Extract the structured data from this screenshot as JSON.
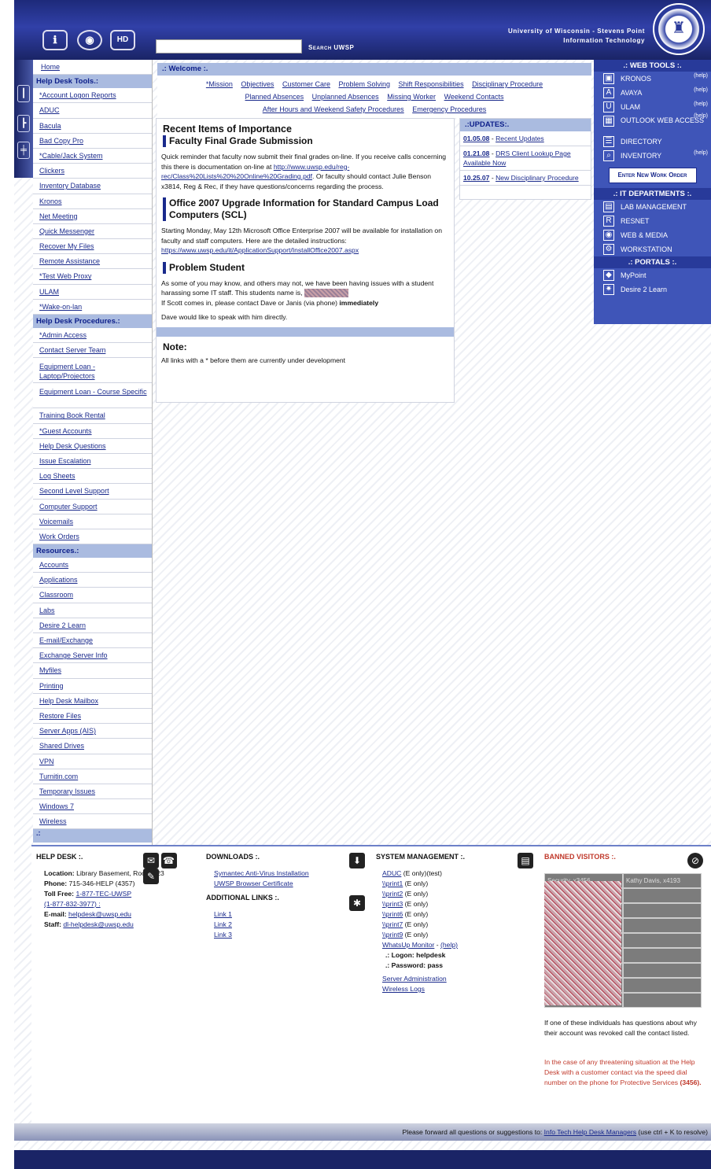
{
  "header": {
    "search_label": "Search UWSP",
    "univ_line1": "University of Wisconsin - Stevens Point",
    "univ_line2": "Information Technology",
    "hd_label": "HD"
  },
  "nav": {
    "home": "Home",
    "tools_head": "Help Desk Tools.:",
    "tools": [
      "*Account Logon Reports",
      "ADUC",
      "Bacula",
      "Bad Copy Pro",
      "*Cable/Jack System",
      "Clickers",
      "Inventory Database",
      "Kronos",
      "Net Meeting",
      "Quick Messenger",
      "Recover My Files",
      "Remote Assistance",
      "*Test Web Proxy",
      "ULAM",
      "*Wake-on-lan"
    ],
    "procedures_head": "Help Desk Procedures.:",
    "procedures": [
      "*Admin Access",
      "Contact Server Team",
      "Equipment Loan - Laptop/Projectors",
      "Equipment Loan - Course Specific",
      "Training Book Rental",
      "*Guest Accounts",
      "Help Desk Questions",
      "Issue Escalation",
      "Log Sheets",
      "Second Level Support",
      "Computer Support",
      "Voicemails",
      "Work Orders"
    ],
    "resources_head": "Resources.:",
    "resources": [
      "Accounts",
      "Applications",
      "Classroom",
      "Labs",
      "Desire 2 Learn",
      "E-mail/Exchange",
      "Exchange Server Info",
      "Myfiles",
      "Printing",
      "Help Desk Mailbox",
      "Restore Files",
      "Server Apps (AIS)",
      "Shared Drives",
      "VPN",
      "Turnitin.com",
      "Temporary Issues",
      "Windows 7",
      "Wireless"
    ],
    "foot": ".:"
  },
  "welcome": {
    "title": ".: Welcome :.",
    "links": [
      "*Mission",
      "Objectives",
      "Customer Care",
      "Problem Solving",
      "Shift Responsibilities",
      "Disciplinary Procedure",
      "Planned Absences",
      "Unplanned Absences",
      "Missing Worker",
      "Weekend Contacts",
      "After Hours and Weekend Safety Procedures",
      "Emergency Procedures"
    ]
  },
  "content": {
    "title": "Recent Items of Importance",
    "item1_title": "Faculty Final Grade Submission",
    "item1_text1": "Quick reminder that faculty now submit their final grades on-line. If you receive calls concerning this there is documentation on-line at",
    "item1_link": "http://www.uwsp.edu/reg-rec/Class%20Lists%20%20Online%20Grading.pdf",
    "item1_text2": ". Or faculty should contact Julie Benson x3814, Reg & Rec, if they have questions/concerns regarding the process.",
    "item2_title": "Office 2007 Upgrade Information for Standard Campus Load Computers (SCL)",
    "item2_text": "Starting Monday, May 12th Microsoft Office Enterprise 2007 will be available for installation on faculty and staff computers. Here are the detailed instructions:",
    "item2_link": "https://www.uwsp.edu/it/ApplicationSupport/InstallOffice2007.aspx",
    "item3_title": "Problem Student",
    "item3_text1": "As some of you may know, and others may not, we have been having issues with a student harassing some IT staff. This students name is,",
    "item3_text2": "If Scott comes in, please contact Dave or Janis (via phone)",
    "item3_bold": "immediately",
    "item3_text3": "Dave would like to speak with him directly.",
    "note_title": "Note:",
    "note_text": "All links with a * before them are currently under development"
  },
  "updates": {
    "title": ".:UPDATES:.",
    "items": [
      {
        "date": "01.05.08",
        "text": "Recent Updates"
      },
      {
        "date": "01.21.08",
        "text": "DRS Client Lookup Page Available Now"
      },
      {
        "date": "10.25.07",
        "text": "New Disciplinary Procedure"
      }
    ]
  },
  "right": {
    "webtools_head": ".: WEB TOOLS :.",
    "webtools": [
      "KRONOS",
      "AVAYA",
      "ULAM",
      "OUTLOOK WEB ACCESS",
      "DIRECTORY",
      "INVENTORY"
    ],
    "help": "(help)",
    "work_order": "Enter New Work Order",
    "depts_head": ".: IT DEPARTMENTS :.",
    "depts": [
      "LAB MANAGEMENT",
      "RESNET",
      "WEB & MEDIA",
      "WORKSTATION"
    ],
    "portals_head": ".: PORTALS :.",
    "portals": [
      "MyPoint",
      "Desire 2 Learn"
    ]
  },
  "footer": {
    "helpdesk_head": "HELP DESK :.",
    "location_label": "Location:",
    "location": "Library Basement, Room 023",
    "phone_label": "Phone:",
    "phone": "715-346-HELP (4357)",
    "tollfree_label": "Toll Free:",
    "tollfree": "1-877-TEC-UWSP",
    "tollfree2": "(1-877-832-3977) :",
    "email_label": "E-mail:",
    "email": "helpdesk@uwsp.edu",
    "staff_label": "Staff:",
    "staff": "dl-helpdesk@uwsp.edu",
    "downloads_head": "DOWNLOADS :.",
    "downloads": [
      "Symantec Anti-Virus Installation",
      "UWSP Browser Certificate"
    ],
    "addl_head": "ADDITIONAL LINKS :.",
    "addl": [
      "Link 1",
      "Link 2",
      "Link 3"
    ],
    "sysmgmt_head": "SYSTEM MANAGEMENT :.",
    "sysmgmt": [
      {
        "link": "ADUC",
        "note": "(E only)(test)"
      },
      {
        "link": "\\\\print1",
        "note": "(E only)"
      },
      {
        "link": "\\\\print2",
        "note": "(E only)"
      },
      {
        "link": "\\\\print3",
        "note": "(E only)"
      },
      {
        "link": "\\\\print6",
        "note": "(E only)"
      },
      {
        "link": "\\\\print7",
        "note": "(E only)"
      },
      {
        "link": "\\\\print9",
        "note": "(E only)"
      }
    ],
    "whatsup": "WhatsUp Monitor",
    "whatsup_help": "(help)",
    "logon": ".: Logon: helpdesk",
    "password": ".: Password: pass",
    "server_admin": "Server Administration",
    "wireless_logs": "Wireless Logs",
    "banned_head": "BANNED VISITORS :.",
    "banned_col1": "Security, x3456",
    "banned_col2": "Kathy Davis, x4193",
    "banned_note": "If one of these individuals has questions about why their account was revoked call the contact listed.",
    "banned_warn": "In the case of any threatening situation at the Help Desk with a customer contact via the speed dial number on the phone for Protective Services",
    "banned_warn_num": "(3456)."
  },
  "bottom": {
    "text": "Please forward all questions or suggestions to:",
    "link": "Info Tech Help Desk Managers",
    "tail": "(use ctrl + K to resolve)"
  },
  "colors": {
    "header": "#2a3a9a",
    "accent": "#aabbe0",
    "right_panel": "#3f55b8",
    "banned": "#c0392b"
  }
}
